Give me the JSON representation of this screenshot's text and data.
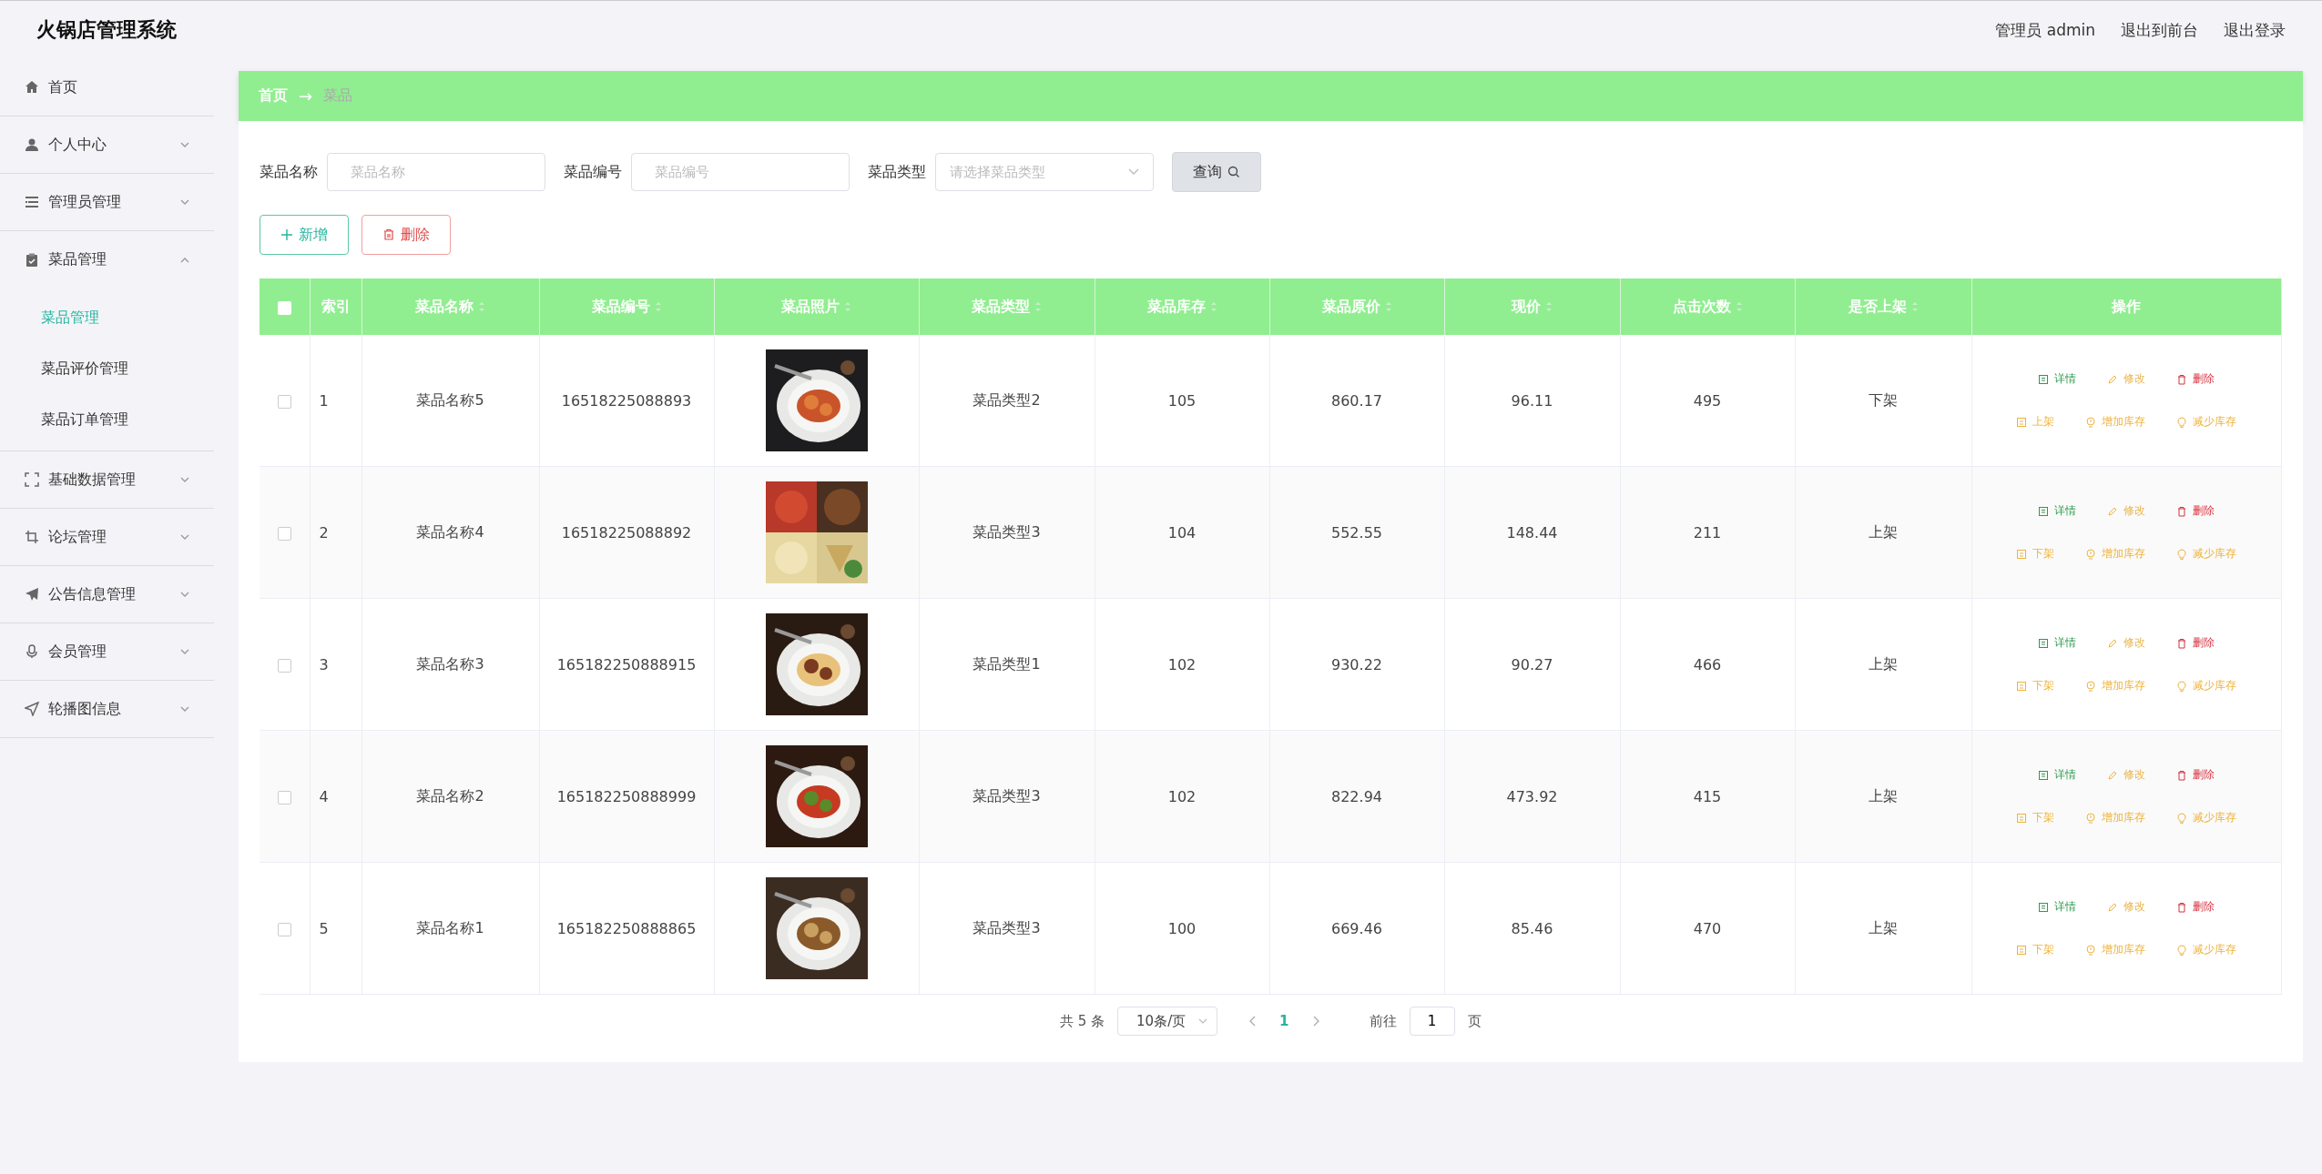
{
  "header": {
    "title": "火锅店管理系统",
    "user": "管理员 admin",
    "links": [
      "退出到前台",
      "退出登录"
    ]
  },
  "sidebar": {
    "items": [
      {
        "label": "首页",
        "kind": "link"
      },
      {
        "label": "个人中心",
        "kind": "menu",
        "expanded": false
      },
      {
        "label": "管理员管理",
        "kind": "menu",
        "expanded": false
      },
      {
        "label": "菜品管理",
        "kind": "menu",
        "expanded": true,
        "children": [
          {
            "label": "菜品管理",
            "selected": true
          },
          {
            "label": "菜品评价管理",
            "selected": false
          },
          {
            "label": "菜品订单管理",
            "selected": false
          }
        ]
      },
      {
        "label": "基础数据管理",
        "kind": "menu",
        "expanded": false
      },
      {
        "label": "论坛管理",
        "kind": "menu",
        "expanded": false
      },
      {
        "label": "公告信息管理",
        "kind": "menu",
        "expanded": false
      },
      {
        "label": "会员管理",
        "kind": "menu",
        "expanded": false
      },
      {
        "label": "轮播图信息",
        "kind": "menu",
        "expanded": false
      }
    ]
  },
  "breadcrumb": {
    "items": [
      "首页",
      "菜品"
    ],
    "separator": "→"
  },
  "search": {
    "fields": [
      {
        "label": "菜品名称",
        "placeholder": "菜品名称",
        "kind": "input"
      },
      {
        "label": "菜品编号",
        "placeholder": "菜品编号",
        "kind": "input"
      },
      {
        "label": "菜品类型",
        "placeholder": "请选择菜品类型",
        "kind": "select"
      }
    ],
    "button": "查询"
  },
  "actions": [
    {
      "label": "新增",
      "kind": "add"
    },
    {
      "label": "删除",
      "kind": "delete"
    }
  ],
  "table": {
    "header_checked": false,
    "columns": [
      {
        "label": "索引",
        "sortable": false
      },
      {
        "label": "菜品名称",
        "sortable": true
      },
      {
        "label": "菜品编号",
        "sortable": true
      },
      {
        "label": "菜品照片",
        "sortable": true
      },
      {
        "label": "菜品类型",
        "sortable": true
      },
      {
        "label": "菜品库存",
        "sortable": true
      },
      {
        "label": "菜品原价",
        "sortable": true
      },
      {
        "label": "现价",
        "sortable": true
      },
      {
        "label": "点击次数",
        "sortable": true
      },
      {
        "label": "是否上架",
        "sortable": true
      },
      {
        "label": "操作",
        "sortable": false
      }
    ],
    "rows": [
      {
        "checked": false,
        "cells": [
          "1",
          "菜品名称5",
          "16518225088893",
          {
            "kind": "picture"
          },
          "菜品类型2",
          "105",
          "860.17",
          "96.11",
          "495",
          "下架"
        ],
        "actions": [
          {
            "label": "详情",
            "kind": "detail"
          },
          {
            "label": "修改",
            "kind": "edit"
          },
          {
            "label": "删除",
            "kind": "delete"
          },
          {
            "label": "上架",
            "kind": "shelf"
          },
          {
            "label": "增加库存",
            "kind": "add_stock"
          },
          {
            "label": "减少库存",
            "kind": "reduce_stock"
          }
        ]
      },
      {
        "checked": false,
        "cells": [
          "2",
          "菜品名称4",
          "16518225088892",
          {
            "kind": "picture"
          },
          "菜品类型3",
          "104",
          "552.55",
          "148.44",
          "211",
          "上架"
        ],
        "actions": [
          {
            "label": "详情",
            "kind": "detail"
          },
          {
            "label": "修改",
            "kind": "edit"
          },
          {
            "label": "删除",
            "kind": "delete"
          },
          {
            "label": "下架",
            "kind": "shelf"
          },
          {
            "label": "增加库存",
            "kind": "add_stock"
          },
          {
            "label": "减少库存",
            "kind": "reduce_stock"
          }
        ]
      },
      {
        "checked": false,
        "cells": [
          "3",
          "菜品名称3",
          "165182250888915",
          {
            "kind": "picture"
          },
          "菜品类型1",
          "102",
          "930.22",
          "90.27",
          "466",
          "上架"
        ],
        "actions": [
          {
            "label": "详情",
            "kind": "detail"
          },
          {
            "label": "修改",
            "kind": "edit"
          },
          {
            "label": "删除",
            "kind": "delete"
          },
          {
            "label": "下架",
            "kind": "shelf"
          },
          {
            "label": "增加库存",
            "kind": "add_stock"
          },
          {
            "label": "减少库存",
            "kind": "reduce_stock"
          }
        ]
      },
      {
        "checked": false,
        "cells": [
          "4",
          "菜品名称2",
          "165182250888999",
          {
            "kind": "picture"
          },
          "菜品类型3",
          "102",
          "822.94",
          "473.92",
          "415",
          "上架"
        ],
        "actions": [
          {
            "label": "详情",
            "kind": "detail"
          },
          {
            "label": "修改",
            "kind": "edit"
          },
          {
            "label": "删除",
            "kind": "delete"
          },
          {
            "label": "下架",
            "kind": "shelf"
          },
          {
            "label": "增加库存",
            "kind": "add_stock"
          },
          {
            "label": "减少库存",
            "kind": "reduce_stock"
          }
        ]
      },
      {
        "checked": false,
        "cells": [
          "5",
          "菜品名称1",
          "165182250888865",
          {
            "kind": "picture"
          },
          "菜品类型3",
          "100",
          "669.46",
          "85.46",
          "470",
          "上架"
        ],
        "actions": [
          {
            "label": "详情",
            "kind": "detail"
          },
          {
            "label": "修改",
            "kind": "edit"
          },
          {
            "label": "删除",
            "kind": "delete"
          },
          {
            "label": "下架",
            "kind": "shelf"
          },
          {
            "label": "增加库存",
            "kind": "add_stock"
          },
          {
            "label": "减少库存",
            "kind": "reduce_stock"
          }
        ]
      }
    ]
  },
  "pager": {
    "total": "共 5 条",
    "page_size": "10条/页",
    "pages": [
      {
        "label": "1",
        "selected": true
      }
    ],
    "jump_label": "前往",
    "jump_value": "1",
    "jump_suffix": "页"
  }
}
